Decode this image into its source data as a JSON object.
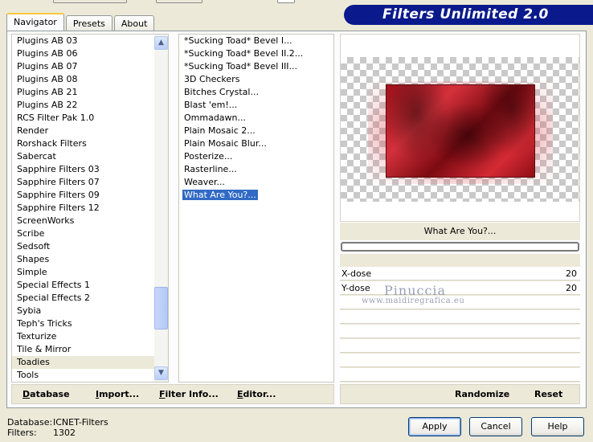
{
  "tabs": [
    {
      "label": "Navigator",
      "active": true
    },
    {
      "label": "Presets",
      "active": false
    },
    {
      "label": "About",
      "active": false
    }
  ],
  "banner": {
    "title": "Filters Unlimited 2.0"
  },
  "categories": {
    "items": [
      "Plugins AB 03",
      "Plugins AB 06",
      "Plugins AB 07",
      "Plugins AB 08",
      "Plugins AB 21",
      "Plugins AB 22",
      "RCS Filter Pak 1.0",
      "Render",
      "Rorshack Filters",
      "Sabercat",
      "Sapphire Filters 03",
      "Sapphire Filters 07",
      "Sapphire Filters 09",
      "Sapphire Filters 12",
      "ScreenWorks",
      "Scribe",
      "Sedsoft",
      "Shapes",
      "Simple",
      "Special Effects 1",
      "Special Effects 2",
      "Sybia",
      "Teph's Tricks",
      "Texturize",
      "Tile & Mirror",
      "Toadies",
      "Tools"
    ],
    "selected": "Toadies"
  },
  "filters": {
    "items": [
      "*Sucking Toad*  Bevel I...",
      "*Sucking Toad*  Bevel II.2...",
      "*Sucking Toad*  Bevel III...",
      "3D Checkers",
      "Bitches Crystal...",
      "Blast 'em!...",
      "Ommadawn...",
      "Plain Mosaic 2...",
      "Plain Mosaic Blur...",
      "Posterize...",
      "Rasterline...",
      "Weaver...",
      "What Are You?..."
    ],
    "selected": "What Are You?..."
  },
  "preview": {
    "filter_name": "What Are You?...",
    "params": [
      {
        "label": "X-dose",
        "value": "20"
      },
      {
        "label": "Y-dose",
        "value": "20"
      }
    ]
  },
  "watermark": {
    "line1": "Pinuccia",
    "line2": "www.maidiregrafica.eu"
  },
  "left_buttons": {
    "database": "Database",
    "import": "Import...",
    "filter_info": "Filter Info...",
    "editor": "Editor..."
  },
  "right_buttons": {
    "randomize": "Randomize",
    "reset": "Reset"
  },
  "status": {
    "db_label": "Database:",
    "db_value": "ICNET-Filters",
    "filters_label": "Filters:",
    "filters_value": "1302"
  },
  "dialog": {
    "apply": "Apply",
    "cancel": "Cancel",
    "help": "Help"
  },
  "colors": {
    "banner_bg": "#0a1a8c",
    "selection": "#316ac5",
    "dialog_bg": "#ece9d8"
  }
}
